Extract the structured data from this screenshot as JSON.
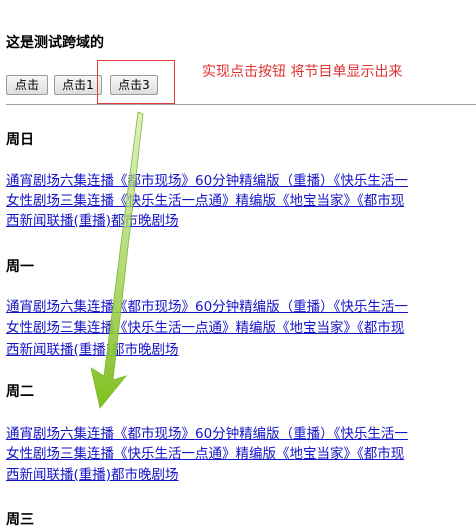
{
  "heading": "这是测试跨域的",
  "buttons": {
    "b1": "点击",
    "b2": "点击1",
    "b3": "点击3"
  },
  "annotation": "实现点击按钮  将节目单显示出来",
  "days": [
    {
      "title": "周日",
      "lines": [
        "通宵剧场六集连播《都市现场》60分钟精编版（重播）《快乐生活一",
        "女性剧场三集连播《快乐生活一点通》精编版《地宝当家》《都市现",
        "西新闻联播(重播)都市晚剧场"
      ]
    },
    {
      "title": "周一",
      "lines": [
        "通宵剧场六集连播《都市现场》60分钟精编版（重播）《快乐生活一",
        "女性剧场三集连播《快乐生活一点通》精编版《地宝当家》《都市现",
        "西新闻联播(重播)都市晚剧场"
      ]
    },
    {
      "title": "周二",
      "lines": [
        "通宵剧场六集连播《都市现场》60分钟精编版（重播）《快乐生活一",
        "女性剧场三集连播《快乐生活一点通》精编版《地宝当家》《都市现",
        "西新闻联播(重播)都市晚剧场"
      ]
    },
    {
      "title": "周三",
      "lines": []
    }
  ],
  "colors": {
    "link": "#1414c8",
    "annotation": "#e0322f",
    "arrow": "#8cc63f"
  }
}
